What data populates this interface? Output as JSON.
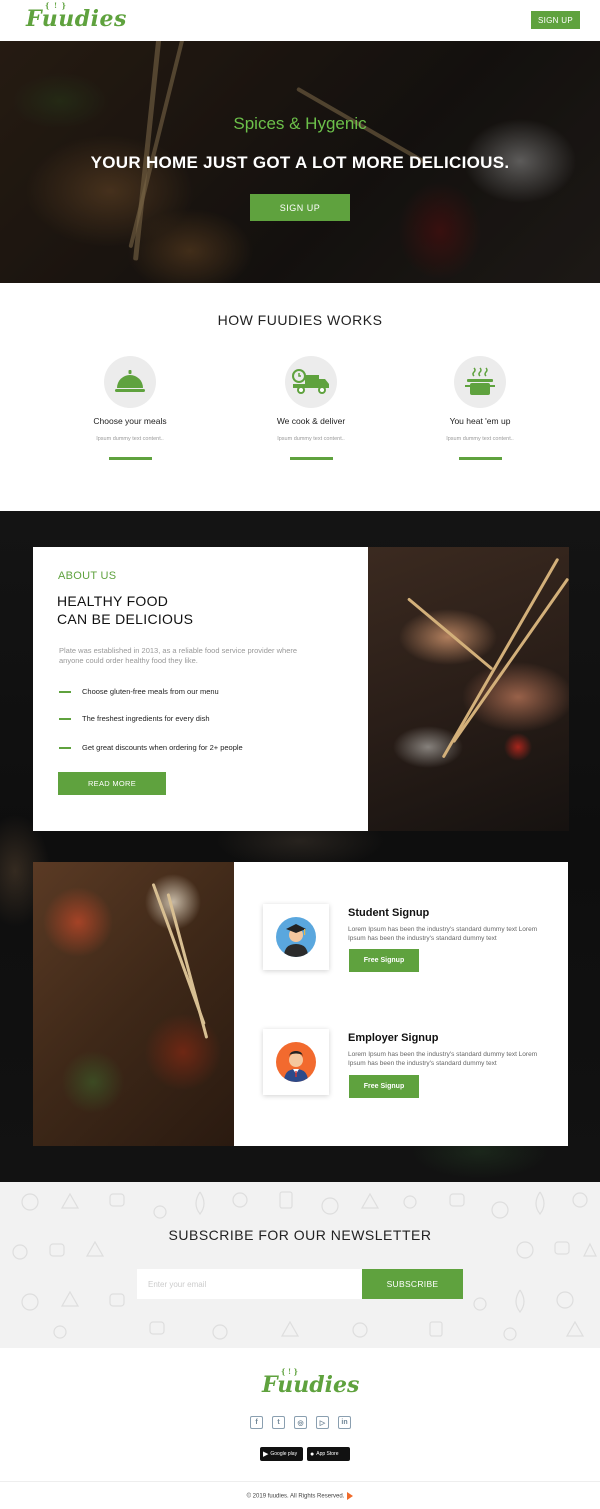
{
  "header": {
    "logo": "Fuudies",
    "signup_label": "SIGN UP"
  },
  "hero": {
    "tagline": "Spices & Hygenic",
    "headline": "YOUR HOME JUST GOT A LOT MORE DELICIOUS.",
    "cta_label": "SIGN UP"
  },
  "how": {
    "title": "HOW FUUDIES WORKS",
    "steps": [
      {
        "icon": "cloche-icon",
        "label": "Choose your meals",
        "desc": "Ipsum dummy text content.."
      },
      {
        "icon": "delivery-truck-icon",
        "label": "We cook & deliver",
        "desc": "Ipsum dummy text content.."
      },
      {
        "icon": "cooking-pot-icon",
        "label": "You heat 'em up",
        "desc": "Ipsum dummy text content.."
      }
    ]
  },
  "about": {
    "kicker": "ABOUT US",
    "title_line1": "HEALTHY FOOD",
    "title_line2": "CAN BE DELICIOUS",
    "body": "Plate was established in 2013, as a reliable food service provider where anyone could order healthy food they like.",
    "items": [
      "Choose gluten-free meals from our menu",
      "The freshest ingredients for every dish",
      "Get great discounts when ordering for 2+ people"
    ],
    "read_more_label": "READ MORE"
  },
  "signups": [
    {
      "icon": "graduate-avatar-icon",
      "heading": "Student Signup",
      "text": "Lorem Ipsum has been the industry's standard dummy text Lorem Ipsum has been the industry's standard dummy text",
      "button": "Free Signup"
    },
    {
      "icon": "employee-avatar-icon",
      "heading": "Employer Signup",
      "text": "Lorem Ipsum has been the industry's standard dummy text Lorem Ipsum has been the industry's standard dummy text",
      "button": "Free Signup"
    }
  ],
  "newsletter": {
    "title": "SUBSCRIBE FOR OUR NEWSLETTER",
    "placeholder": "Enter your email",
    "button": "SUBSCRIBE"
  },
  "footer": {
    "logo": "Fuudies",
    "socials": [
      "facebook-icon",
      "twitter-icon",
      "instagram-icon",
      "youtube-icon",
      "linkedin-icon"
    ],
    "google_play": "Google play",
    "app_store": "App Store",
    "copyright": "© 2019 fuudies. All Rights Reserved."
  },
  "colors": {
    "brand_green": "#5fa23e",
    "hero_tagline_green": "#6cc04a",
    "dark_bg": "#121212"
  }
}
